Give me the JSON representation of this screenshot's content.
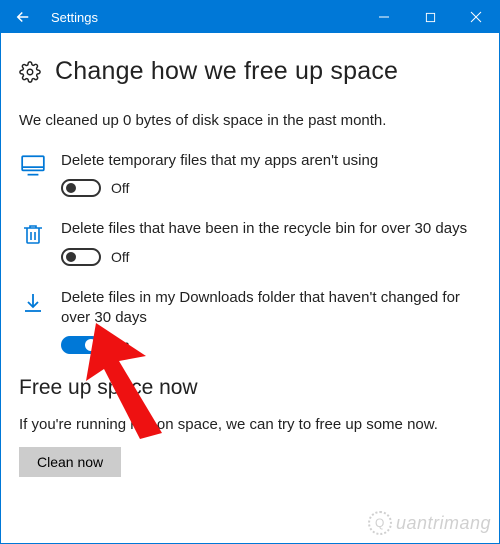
{
  "titlebar": {
    "title": "Settings"
  },
  "page": {
    "heading": "Change how we free up space",
    "status": "We cleaned up 0 bytes of disk space in the past month."
  },
  "options": [
    {
      "icon": "monitor",
      "label": "Delete temporary files that my apps aren't using",
      "state": "off",
      "stateLabel": "Off"
    },
    {
      "icon": "trash",
      "label": "Delete files that have been in the recycle bin for over 30 days",
      "state": "off",
      "stateLabel": "Off"
    },
    {
      "icon": "download",
      "label": "Delete files in my Downloads folder that haven't changed for over 30 days",
      "state": "on",
      "stateLabel": "On"
    }
  ],
  "freeup": {
    "heading": "Free up space now",
    "text": "If you're running low on space, we can try to free up some now.",
    "button": "Clean now"
  },
  "watermark": "uantrimang",
  "colors": {
    "accent": "#0078d7"
  }
}
